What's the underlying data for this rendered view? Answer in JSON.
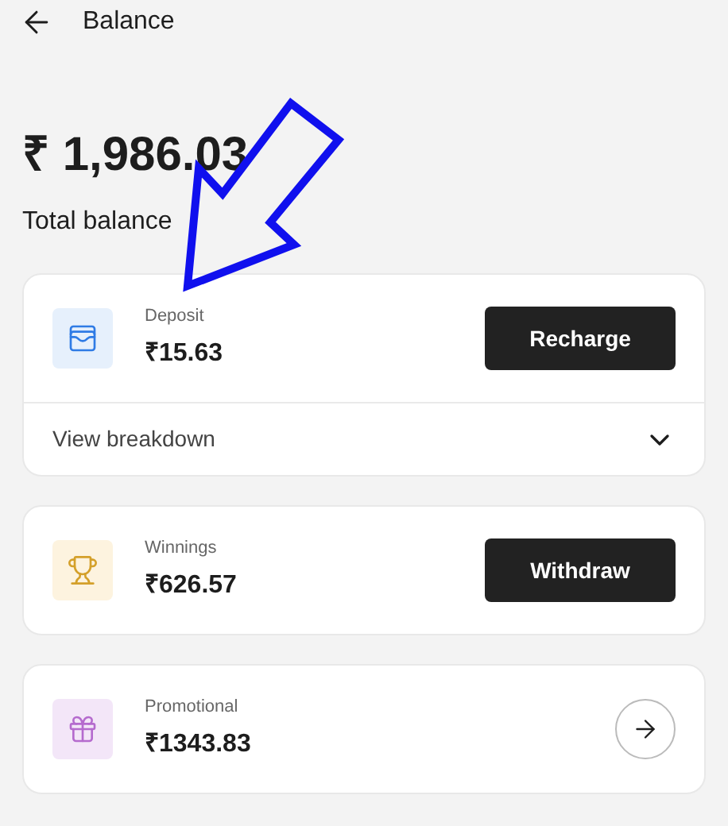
{
  "header": {
    "title": "Balance"
  },
  "total": {
    "amount": "₹ 1,986.03",
    "label": "Total balance"
  },
  "accounts": [
    {
      "kind": "button",
      "label": "Deposit",
      "amount": "₹15.63",
      "action": "Recharge",
      "breakdown": {
        "label": "View breakdown",
        "expanded": false
      }
    },
    {
      "kind": "button",
      "label": "Winnings",
      "amount": "₹626.57",
      "action": "Withdraw"
    },
    {
      "kind": "arrow",
      "label": "Promotional",
      "amount": "₹1343.83"
    }
  ]
}
